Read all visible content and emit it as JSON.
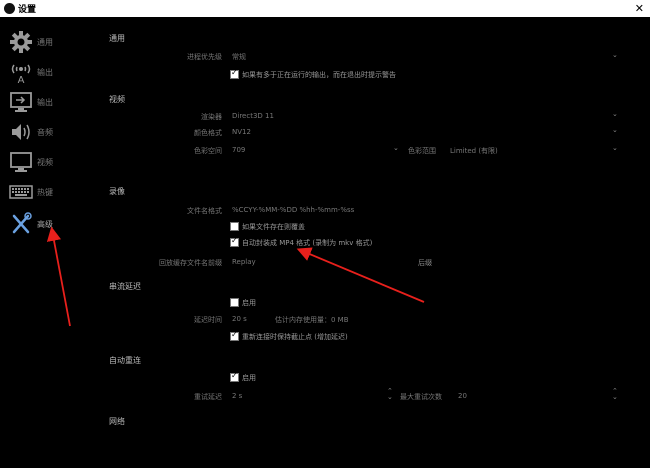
{
  "window": {
    "title": "设置",
    "close_glyph": "✕"
  },
  "sidebar": {
    "items": [
      {
        "label": "通用",
        "icon": "gear-icon"
      },
      {
        "label": "输出",
        "icon": "broadcast-icon"
      },
      {
        "label": "输出",
        "icon": "monitor-icon"
      },
      {
        "label": "音频",
        "icon": "speaker-icon"
      },
      {
        "label": "视频",
        "icon": "display-icon"
      },
      {
        "label": "热键",
        "icon": "keyboard-icon"
      },
      {
        "label": "高级",
        "icon": "tools-icon"
      }
    ],
    "active_index": 6
  },
  "general": {
    "header": "通用",
    "process_priority_label": "进程优先级",
    "process_priority_value": "常规",
    "confirm_exit_label": "如果有多于正在运行的输出，而在退出时提示警告"
  },
  "video": {
    "header": "视频",
    "renderer_label": "渲染器",
    "renderer_value": "Direct3D 11",
    "color_format_label": "颜色格式",
    "color_format_value": "NV12",
    "color_space_label": "色彩空间",
    "color_space_value": "709",
    "color_range_label": "色彩范围",
    "color_range_value": "Limited (有限)"
  },
  "recording": {
    "header": "录像",
    "filename_format_label": "文件名格式",
    "filename_format_value": "%CCYY-%MM-%DD %hh-%mm-%ss",
    "overwrite_label": "如果文件存在则覆盖",
    "auto_remux_label": "自动封装成 MP4 格式 (录制为 mkv 格式)",
    "replay_prefix_label": "回放缓存文件名前缀",
    "replay_prefix_value": "Replay",
    "browse_label": "后缀"
  },
  "stream_delay": {
    "header": "串流延迟",
    "enable_label": "启用",
    "duration_label": "延迟时间",
    "duration_value": "20 s",
    "estimate_label": "估计内存使用量：0 MB",
    "preserve_label": "重新连接时保持截止点 (增加延迟)"
  },
  "auto_reconnect": {
    "header": "自动重连",
    "enable_label": "启用",
    "retry_delay_label": "重试延迟",
    "retry_delay_value": "2 s",
    "max_retries_label": "最大重试次数",
    "max_retries_value": "20"
  },
  "network": {
    "header": "网络"
  },
  "colors": {
    "background": "#000000",
    "titlebar": "#ffffff",
    "annotation_arrow": "#e8201c"
  }
}
